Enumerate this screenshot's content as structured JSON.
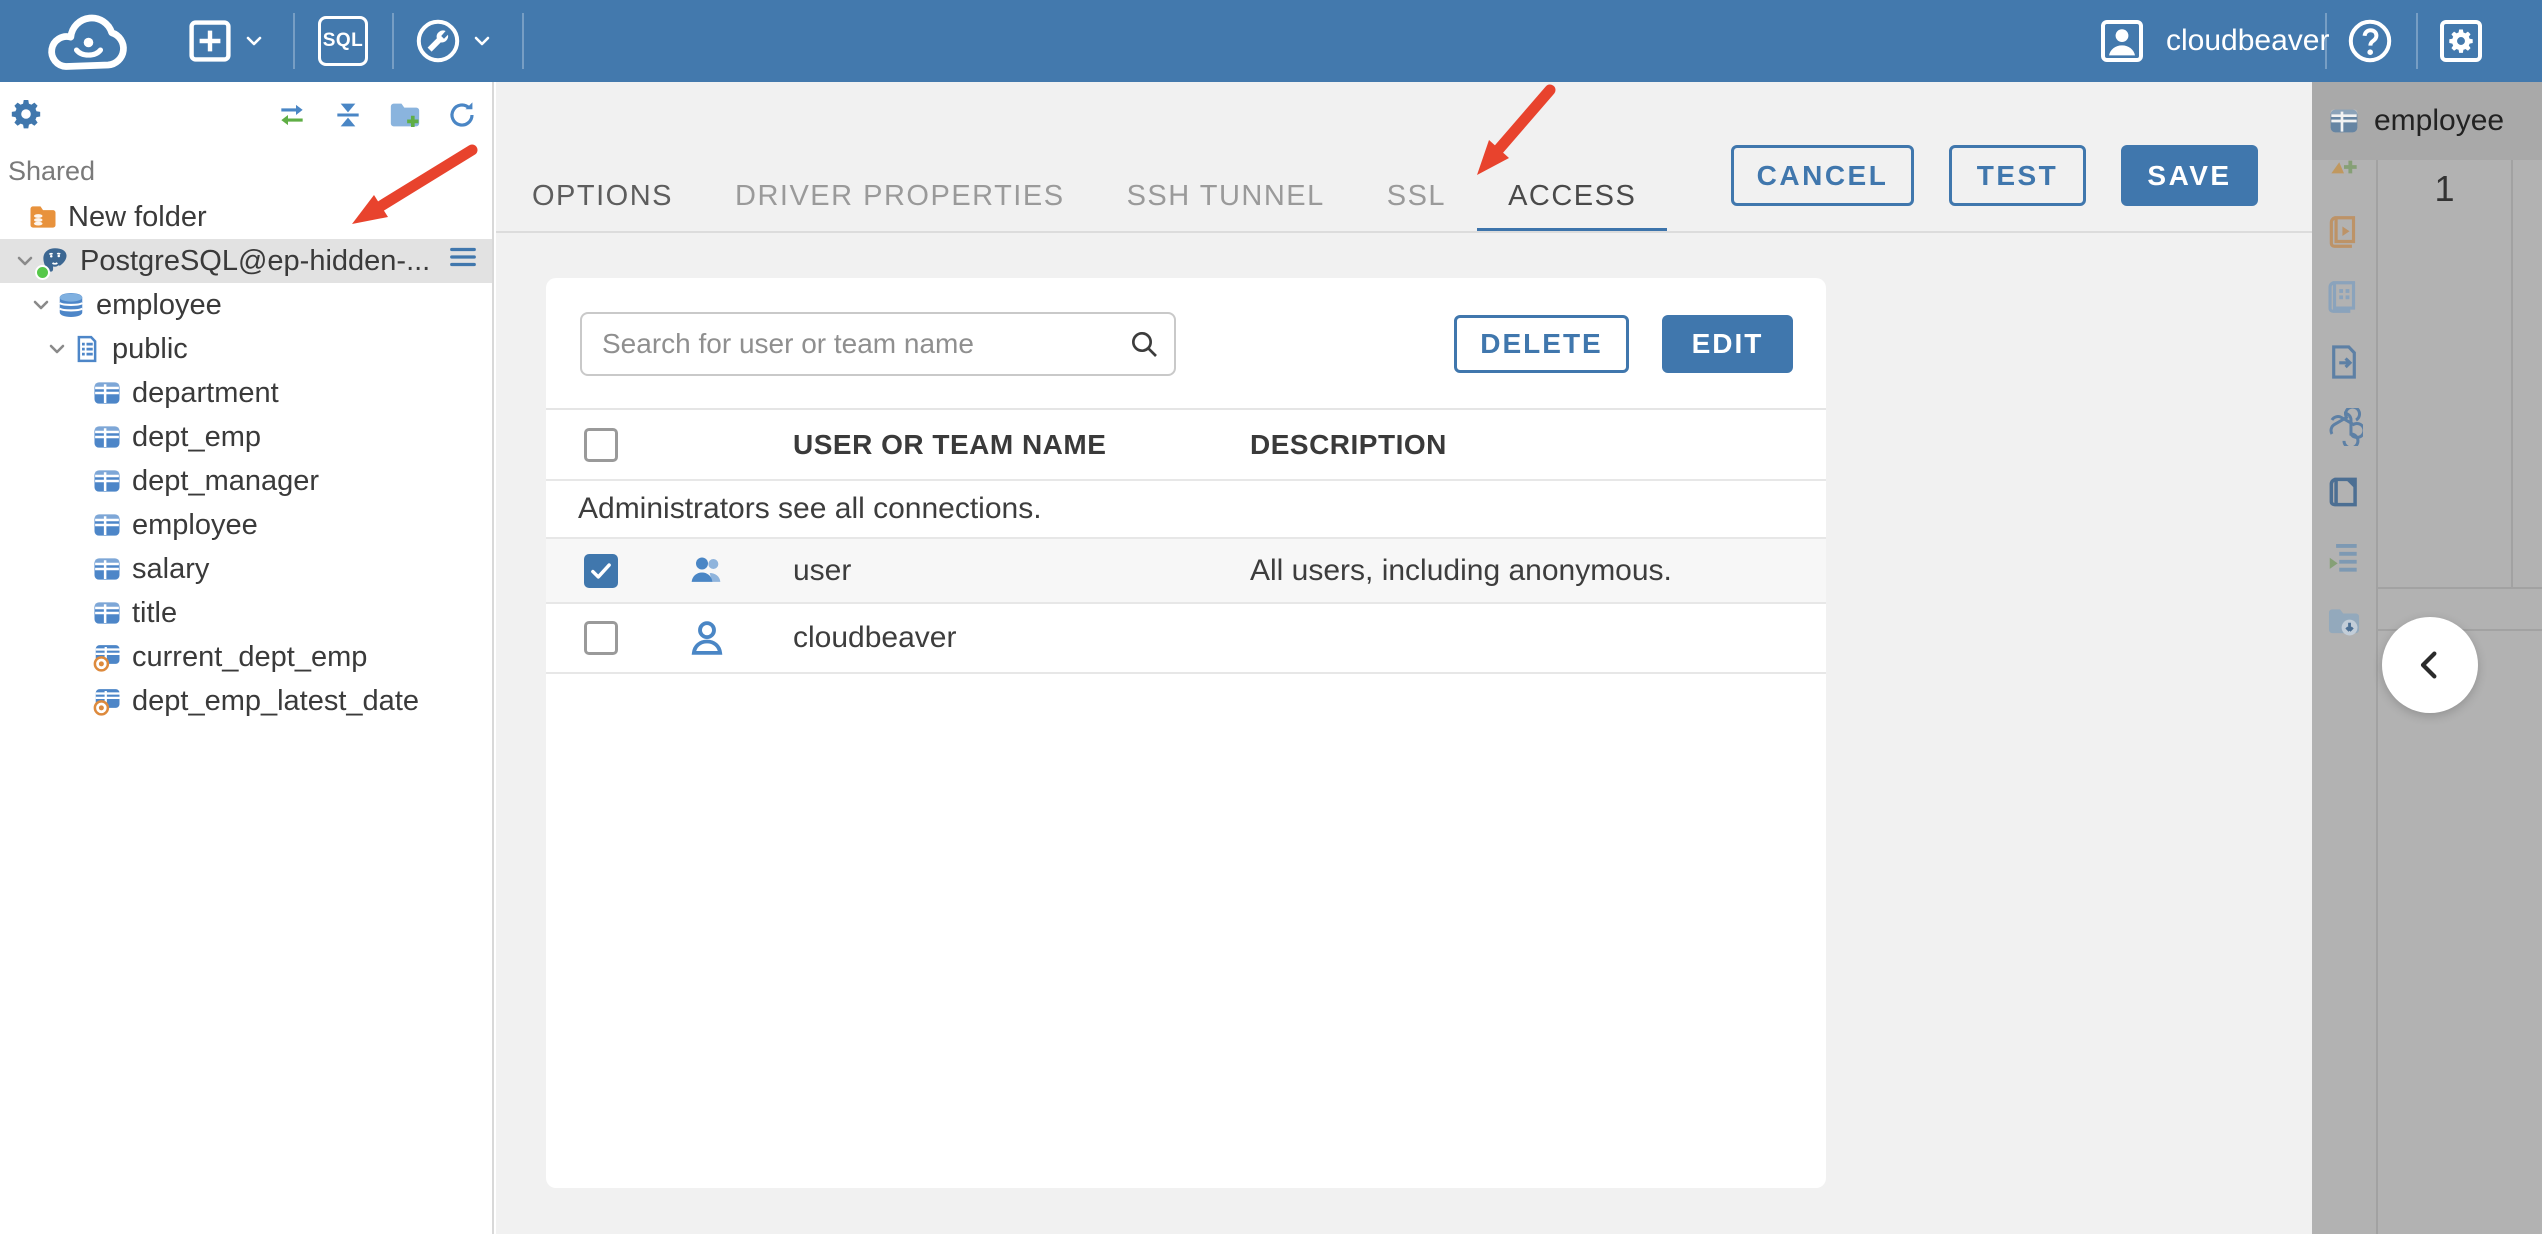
{
  "colors": {
    "topbar": "#4379ad",
    "accent": "#4077ad",
    "arrow": "#e8432d",
    "status_connected": "#57c84a",
    "selected_row": "#e2e2e2"
  },
  "topbar": {
    "sql_label": "SQL",
    "user_label": "cloudbeaver"
  },
  "sidebar": {
    "section_label": "Shared",
    "tree": [
      {
        "label": "New folder",
        "icon": "folder-database"
      },
      {
        "label": "PostgreSQL@ep-hidden-...",
        "icon": "postgresql-connection",
        "status": "connected",
        "selected": true
      },
      {
        "label": "employee",
        "icon": "database"
      },
      {
        "label": "public",
        "icon": "schema"
      },
      {
        "label": "department",
        "icon": "table"
      },
      {
        "label": "dept_emp",
        "icon": "table"
      },
      {
        "label": "dept_manager",
        "icon": "table"
      },
      {
        "label": "employee",
        "icon": "table"
      },
      {
        "label": "salary",
        "icon": "table"
      },
      {
        "label": "title",
        "icon": "table"
      },
      {
        "label": "current_dept_emp",
        "icon": "view"
      },
      {
        "label": "dept_emp_latest_date",
        "icon": "view"
      }
    ]
  },
  "dialog": {
    "tabs": [
      "OPTIONS",
      "DRIVER PROPERTIES",
      "SSH TUNNEL",
      "SSL",
      "ACCESS"
    ],
    "active_tab": "ACCESS",
    "buttons": {
      "cancel": "CANCEL",
      "test": "TEST",
      "save": "SAVE"
    },
    "access": {
      "search_placeholder": "Search for user or team name",
      "delete_label": "DELETE",
      "edit_label": "EDIT",
      "columns": [
        "USER OR TEAM NAME",
        "DESCRIPTION"
      ],
      "info_row": "Administrators see all connections.",
      "rows": [
        {
          "checked": true,
          "icon": "team",
          "name": "user",
          "description": "All users, including anonymous."
        },
        {
          "checked": false,
          "icon": "person",
          "name": "cloudbeaver",
          "description": ""
        }
      ]
    }
  },
  "right_panel": {
    "tab_label": "employee",
    "tab_icon": "table",
    "cell_value": "1",
    "rail_icons": [
      "add",
      "script",
      "grid-form",
      "export-document",
      "ai-assistant",
      "open-panel",
      "execution-plan",
      "save-results"
    ]
  }
}
